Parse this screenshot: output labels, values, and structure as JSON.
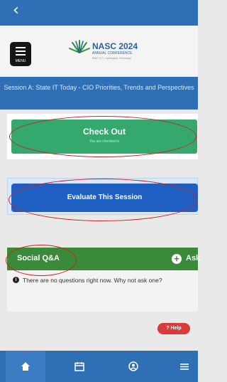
{
  "nav": {
    "back_glyph": "‹"
  },
  "header": {
    "menu_label": "MENU",
    "logo_title": "NASC 2024",
    "logo_subtitle": "ANNUAL CONFERENCE",
    "logo_small": "MAY 3-7  •  Lexington, Kentucky"
  },
  "session": {
    "title": "Session A: State IT Today - CIO Priorities, Trends and Perspectives"
  },
  "checkout": {
    "label": "Check Out",
    "sublabel": "You are checked in"
  },
  "evaluate": {
    "label": "Evaluate This Session"
  },
  "social": {
    "title": "Social Q&A",
    "ask_label": "Ask",
    "empty_text": "There are no questions right now. Why not ask one?"
  },
  "help": {
    "label": "Help"
  },
  "tabbar": {
    "items": [
      "home-icon",
      "calendar-icon",
      "person-icon",
      "menu-icon"
    ]
  },
  "colors": {
    "primary": "#2f6fb6",
    "success": "#35a86d",
    "cta": "#1f5fc2",
    "social": "#3a8a3a",
    "help": "#d93a3a",
    "annotation": "#d21f1f"
  }
}
